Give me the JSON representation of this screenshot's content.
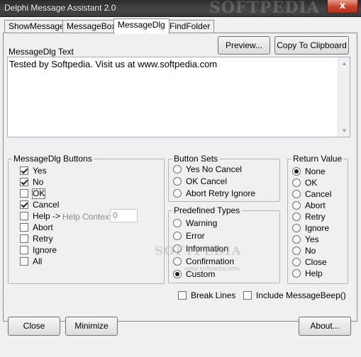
{
  "window": {
    "title": "Delphi Message Assistant 2.0",
    "watermark": "SOFTPEDIA",
    "close_glyph": "x"
  },
  "tabs": [
    {
      "label": "ShowMessage",
      "active": false
    },
    {
      "label": "MessageBox",
      "active": false
    },
    {
      "label": "MessageDlg",
      "active": true
    },
    {
      "label": "FindFolder",
      "active": false
    }
  ],
  "messagedlg": {
    "text_label": "MessageDlg Text",
    "preview_button": "Preview...",
    "copy_button": "Copy To Clipboard",
    "text_value": "Tested by Softpedia. Visit us at www.softpedia.com",
    "buttons_group": {
      "legend": "MessageDlg Buttons",
      "items": [
        {
          "label": "Yes",
          "checked": true
        },
        {
          "label": "No",
          "checked": true
        },
        {
          "label": "OK",
          "checked": false
        },
        {
          "label": "Cancel",
          "checked": true
        },
        {
          "label": "Help ->",
          "checked": false
        },
        {
          "label": "Abort",
          "checked": false
        },
        {
          "label": "Retry",
          "checked": false
        },
        {
          "label": "Ignore",
          "checked": false
        },
        {
          "label": "All",
          "checked": false
        }
      ],
      "help_context_label": "Help Context",
      "help_context_value": "0"
    },
    "button_sets": {
      "legend": "Button Sets",
      "items": [
        "Yes No Cancel",
        "OK Cancel",
        "Abort Retry Ignore"
      ]
    },
    "predefined_types": {
      "legend": "Predefined Types",
      "items": [
        "Warning",
        "Error",
        "Information",
        "Confirmation",
        "Custom"
      ],
      "selected": "Custom"
    },
    "return_value": {
      "legend": "Return Value",
      "items": [
        "None",
        "OK",
        "Cancel",
        "Abort",
        "Retry",
        "Ignore",
        "Yes",
        "No",
        "Close",
        "Help"
      ],
      "selected": "None"
    },
    "break_lines": {
      "label": "Break Lines",
      "checked": false
    },
    "include_beep": {
      "label": "Include MessageBeep()",
      "checked": false
    },
    "center_watermark": "SOFTPEDIA",
    "watermark_url": "www.softpedia.com"
  },
  "footer": {
    "close_button": "Close",
    "minimize_button": "Minimize",
    "about_button": "About..."
  }
}
